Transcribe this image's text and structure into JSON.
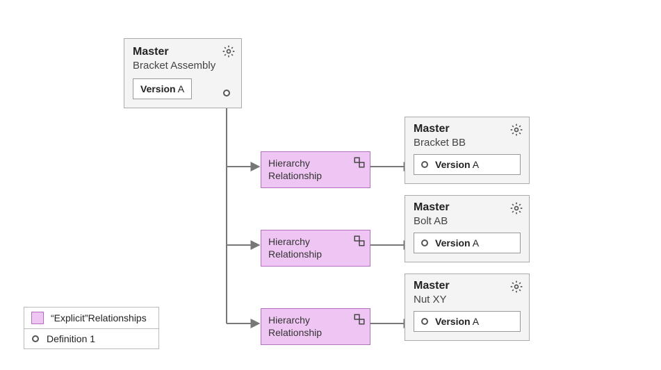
{
  "root": {
    "title": "Master",
    "subtitle": "Bracket Assembly",
    "version_label": "Version",
    "version_value": "A"
  },
  "relationships": [
    {
      "label_line1": "Hierarchy",
      "label_line2": "Relationship"
    },
    {
      "label_line1": "Hierarchy",
      "label_line2": "Relationship"
    },
    {
      "label_line1": "Hierarchy",
      "label_line2": "Relationship"
    }
  ],
  "children": [
    {
      "title": "Master",
      "subtitle": "Bracket BB",
      "version_label": "Version",
      "version_value": "A"
    },
    {
      "title": "Master",
      "subtitle": "Bolt AB",
      "version_label": "Version",
      "version_value": "A"
    },
    {
      "title": "Master",
      "subtitle": "Nut XY",
      "version_label": "Version",
      "version_value": "A"
    }
  ],
  "legend": {
    "explicit": "“Explicit”Relationships",
    "def1": "Definition 1"
  }
}
